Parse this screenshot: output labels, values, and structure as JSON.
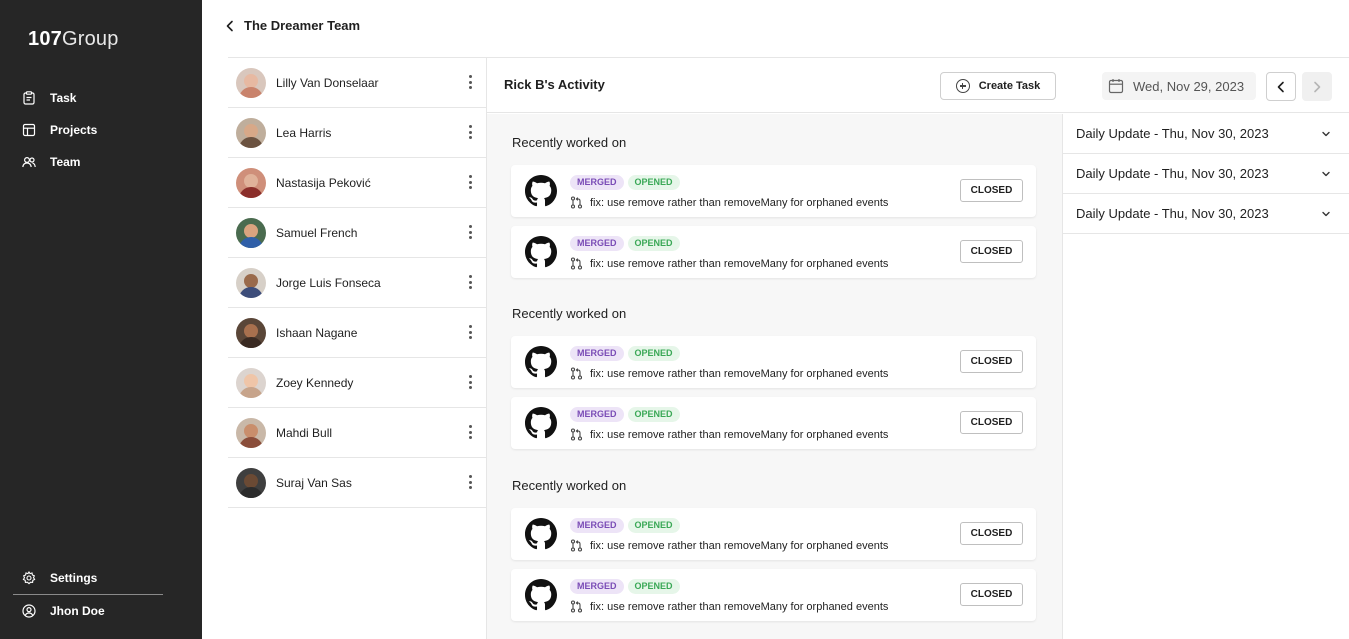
{
  "sidebar": {
    "logo_bold": "107",
    "logo_light": "Group",
    "nav": [
      {
        "label": "Task",
        "icon": "clipboard-icon"
      },
      {
        "label": "Projects",
        "icon": "table-icon"
      },
      {
        "label": "Team",
        "icon": "users-icon"
      }
    ],
    "settings_label": "Settings",
    "user_label": "Jhon Doe"
  },
  "header": {
    "back_title": "The Dreamer Team"
  },
  "members": [
    {
      "name": "Lilly Van Donselaar",
      "skin": "#e7b9a2",
      "shirt": "#c9836c",
      "bg": "#d9c7bd"
    },
    {
      "name": "Lea Harris",
      "skin": "#d7a888",
      "shirt": "#6b5240",
      "bg": "#bfae9c"
    },
    {
      "name": "Nastasija Peković",
      "skin": "#e0b29a",
      "shirt": "#8b2e2a",
      "bg": "#cf8f7a"
    },
    {
      "name": "Samuel French",
      "skin": "#d9a37f",
      "shirt": "#2f5fa8",
      "bg": "#4a6b4f"
    },
    {
      "name": "Jorge Luis Fonseca",
      "skin": "#9a6a4b",
      "shirt": "#3d4d7a",
      "bg": "#d7d0c8"
    },
    {
      "name": "Ishaan Nagane",
      "skin": "#a8704e",
      "shirt": "#3a2a22",
      "bg": "#5a4638"
    },
    {
      "name": "Zoey Kennedy",
      "skin": "#efc5a8",
      "shirt": "#c7a48b",
      "bg": "#dcd4cf"
    },
    {
      "name": "Mahdi Bull",
      "skin": "#c98e6c",
      "shirt": "#8a4d3a",
      "bg": "#c9b8a8"
    },
    {
      "name": "Suraj Van Sas",
      "skin": "#6b4a34",
      "shirt": "#2b2b2b",
      "bg": "#3f3f3f"
    }
  ],
  "activity": {
    "title": "Rick B's Activity",
    "create_task_label": "Create Task",
    "date": "Wed, Nov 29, 2023",
    "sections": [
      {
        "title": "Recently worked on",
        "items": [
          {
            "badge1": "MERGED",
            "badge2": "OPENED",
            "text": "fix: use remove rather than removeMany for orphaned events",
            "button": "CLOSED"
          },
          {
            "badge1": "MERGED",
            "badge2": "OPENED",
            "text": "fix: use remove rather than removeMany for orphaned events",
            "button": "CLOSED"
          }
        ]
      },
      {
        "title": "Recently worked on",
        "items": [
          {
            "badge1": "MERGED",
            "badge2": "OPENED",
            "text": "fix: use remove rather than removeMany for orphaned events",
            "button": "CLOSED"
          },
          {
            "badge1": "MERGED",
            "badge2": "OPENED",
            "text": "fix: use remove rather than removeMany for orphaned events",
            "button": "CLOSED"
          }
        ]
      },
      {
        "title": "Recently worked on",
        "items": [
          {
            "badge1": "MERGED",
            "badge2": "OPENED",
            "text": "fix: use remove rather than removeMany for orphaned events",
            "button": "CLOSED"
          },
          {
            "badge1": "MERGED",
            "badge2": "OPENED",
            "text": "fix: use remove rather than removeMany for orphaned events",
            "button": "CLOSED"
          }
        ]
      }
    ]
  },
  "updates": [
    {
      "label": "Daily Update - Thu, Nov 30, 2023"
    },
    {
      "label": "Daily Update - Thu, Nov 30, 2023"
    },
    {
      "label": "Daily Update - Thu, Nov 30, 2023"
    }
  ]
}
